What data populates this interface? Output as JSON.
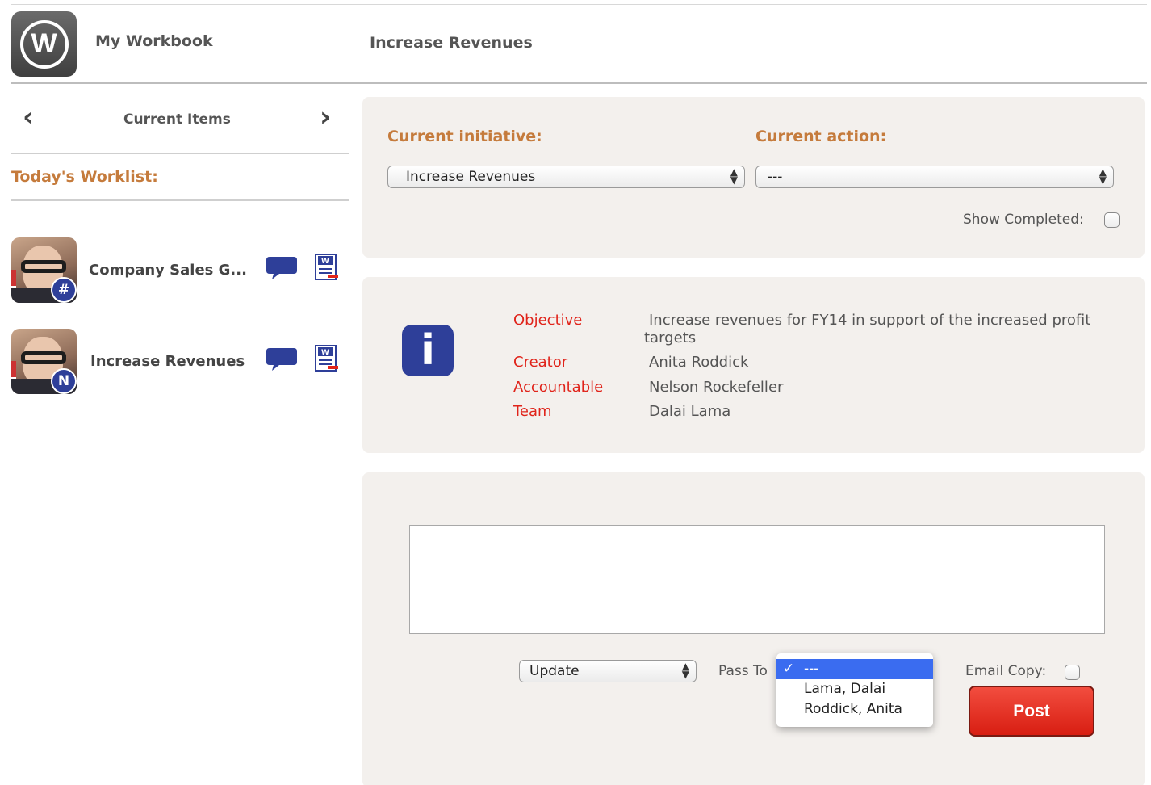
{
  "header": {
    "logo_letter": "W",
    "app_title": "My Workbook",
    "page_title": "Increase Revenues"
  },
  "sidebar": {
    "prev_icon": "chevron-left-icon",
    "next_icon": "chevron-right-icon",
    "nav_label": "Current Items",
    "worklist_title": "Today's Worklist:",
    "items": [
      {
        "label": "Company Sales G...",
        "badge": "#",
        "comment_icon": "speech-bubble-icon",
        "doc_icon": "workbook-doc-icon"
      },
      {
        "label": "Increase Revenues",
        "badge": "N",
        "comment_icon": "speech-bubble-icon",
        "doc_icon": "workbook-doc-icon"
      }
    ]
  },
  "selection_panel": {
    "initiative_label": "Current initiative:",
    "initiative_value": "Increase Revenues",
    "action_label": "Current action:",
    "action_value": "---",
    "show_completed_label": "Show Completed:",
    "show_completed_checked": false
  },
  "info_panel": {
    "icon": "info-icon",
    "icon_glyph": "i",
    "objective_label": "Objective",
    "objective_value": "Increase revenues for FY14 in support of the increased profit targets",
    "creator_label": "Creator",
    "creator_value": "Anita Roddick",
    "accountable_label": "Accountable",
    "accountable_value": "Nelson Rockefeller",
    "team_label": "Team",
    "team_value": "Dalai Lama"
  },
  "post_panel": {
    "textarea_value": "",
    "type_value": "Update",
    "pass_to_label": "Pass To",
    "pass_to_options": [
      "---",
      "Lama, Dalai",
      "Roddick, Anita"
    ],
    "pass_to_selected": "---",
    "email_copy_label": "Email Copy:",
    "email_copy_checked": false,
    "post_label": "Post"
  },
  "colors": {
    "accent_orange": "#c57b3c",
    "label_red": "#e0241b",
    "brand_blue": "#2e3f99",
    "post_red": "#e0261b",
    "panel_bg": "#f3f0ed"
  }
}
